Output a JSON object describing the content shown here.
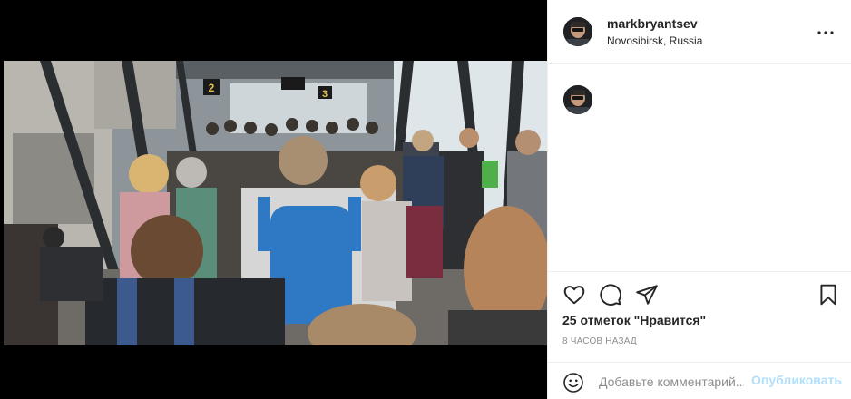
{
  "post": {
    "image": {
      "description_icon": "photo",
      "gate_signs": [
        "2",
        "3"
      ]
    },
    "header": {
      "username": "markbryantsev",
      "location": "Novosibirsk, Russia",
      "more_icon": "more-horizontal-icon"
    },
    "actions": {
      "like_icon": "heart-icon",
      "comment_icon": "comment-icon",
      "share_icon": "paper-plane-icon",
      "save_icon": "bookmark-icon",
      "likes_text": "25 отметок \"Нравится\"",
      "timestamp": "8 ЧАСОВ НАЗАД"
    },
    "composer": {
      "emoji_icon": "smiley-icon",
      "placeholder": "Добавьте комментарий...",
      "publish_label": "Опубликовать",
      "publish_color": "#b2dffc"
    }
  }
}
